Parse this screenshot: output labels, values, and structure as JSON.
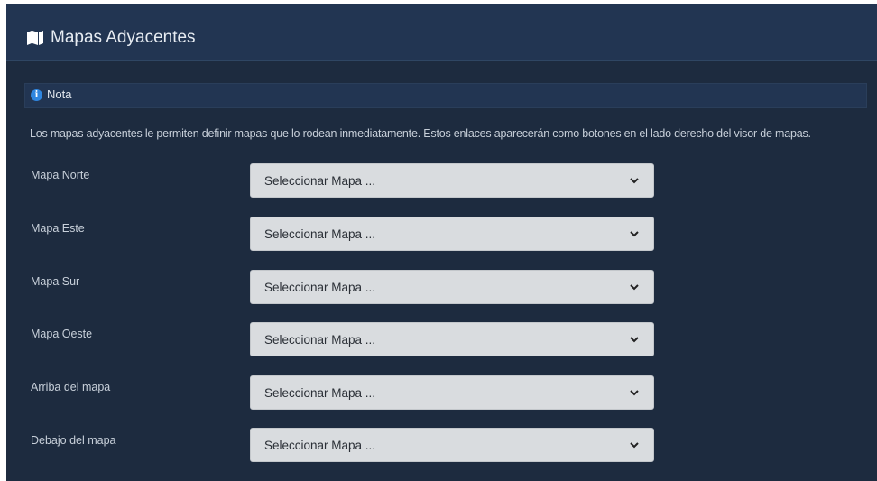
{
  "panel": {
    "title": "Mapas Adyacentes",
    "title_icon": "map-icon"
  },
  "note": {
    "title": "Nota",
    "icon": "info-icon",
    "text": "Los mapas adyacentes le permiten definir mapas que lo rodean inmediatamente. Estos enlaces aparecerán como botones en el lado derecho del visor de mapas."
  },
  "fields": [
    {
      "label": "Mapa Norte",
      "value": "Seleccionar Mapa ..."
    },
    {
      "label": "Mapa Este",
      "value": "Seleccionar Mapa ..."
    },
    {
      "label": "Mapa Sur",
      "value": "Seleccionar Mapa ..."
    },
    {
      "label": "Mapa Oeste",
      "value": "Seleccionar Mapa ..."
    },
    {
      "label": "Arriba del mapa",
      "value": "Seleccionar Mapa ..."
    },
    {
      "label": "Debajo del mapa",
      "value": "Seleccionar Mapa ..."
    }
  ],
  "colors": {
    "panel_bg": "#1d2b3f",
    "header_bg": "#223552",
    "select_bg": "#d9dcdf",
    "info_accent": "#2f86e0"
  }
}
